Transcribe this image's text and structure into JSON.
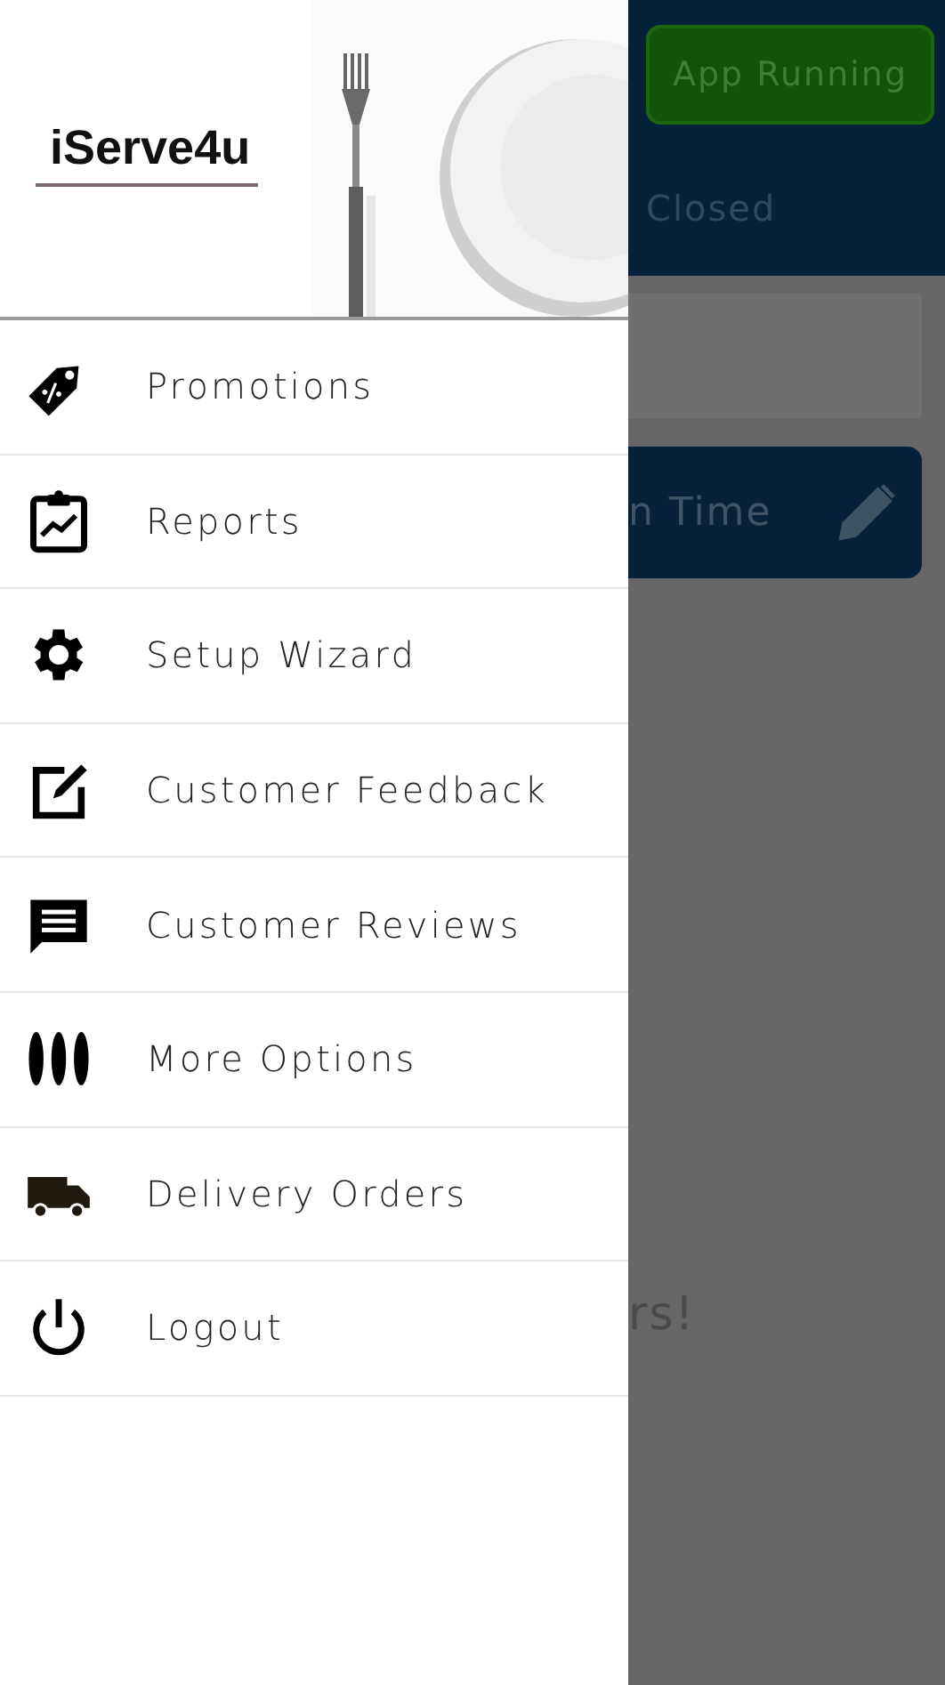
{
  "drawer": {
    "logo": "iServe4u",
    "items": [
      {
        "label": "Promotions"
      },
      {
        "label": "Reports"
      },
      {
        "label": "Setup Wizard"
      },
      {
        "label": "Customer Feedback"
      },
      {
        "label": "Customer Reviews"
      },
      {
        "label": "More Options"
      },
      {
        "label": "Delivery Orders"
      },
      {
        "label": "Logout"
      }
    ]
  },
  "background": {
    "status_button": "App Running",
    "status_text": "Closed",
    "time_button": "n Time",
    "message": "rs!"
  }
}
